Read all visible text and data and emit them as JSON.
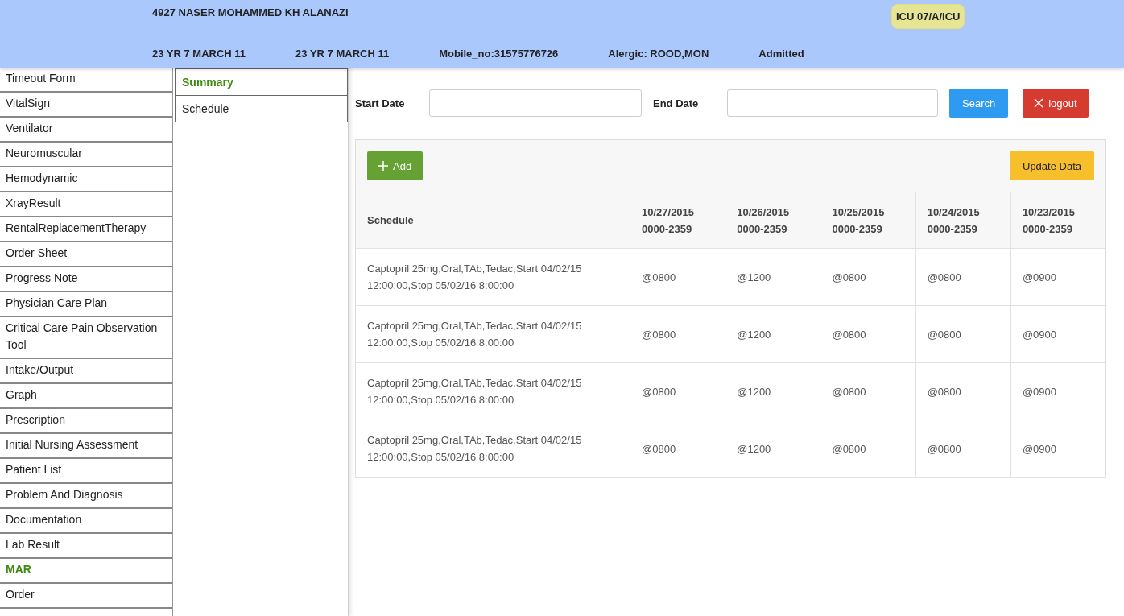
{
  "header": {
    "patient_name": "4927 NASER MOHAMMED KH ALANAZI",
    "location": "ICU 07/A/ICU",
    "details": [
      "23 YR 7 MARCH 11",
      "23 YR 7 MARCH 11",
      "Mobile_no:31575776726",
      "Alergic: ROOD,MON",
      "Admitted"
    ]
  },
  "sidebar": {
    "items": [
      {
        "label": "Timeout Form",
        "selected": false
      },
      {
        "label": "VitalSign",
        "selected": false
      },
      {
        "label": "Ventilator",
        "selected": false
      },
      {
        "label": "Neuromuscular",
        "selected": false
      },
      {
        "label": "Hemodynamic",
        "selected": false
      },
      {
        "label": "XrayResult",
        "selected": false
      },
      {
        "label": "RentalReplacementTherapy",
        "selected": false
      },
      {
        "label": "Order Sheet",
        "selected": false
      },
      {
        "label": "Progress Note",
        "selected": false
      },
      {
        "label": "Physician Care Plan",
        "selected": false
      },
      {
        "label": "Critical Care Pain Observation Tool",
        "selected": false
      },
      {
        "label": "Intake/Output",
        "selected": false
      },
      {
        "label": "Graph",
        "selected": false
      },
      {
        "label": "Prescription",
        "selected": false
      },
      {
        "label": "Initial Nursing Assessment",
        "selected": false
      },
      {
        "label": "Patient List",
        "selected": false
      },
      {
        "label": "Problem And Diagnosis",
        "selected": false
      },
      {
        "label": "Documentation",
        "selected": false
      },
      {
        "label": "Lab Result",
        "selected": false
      },
      {
        "label": "MAR",
        "selected": true
      },
      {
        "label": "Order",
        "selected": false
      }
    ]
  },
  "submenu": {
    "items": [
      {
        "label": "Summary",
        "selected": true
      },
      {
        "label": "Schedule",
        "selected": false
      }
    ]
  },
  "filters": {
    "start_date_label": "Start Date",
    "end_date_label": "End Date",
    "search_button": "Search",
    "logout_button": "logout"
  },
  "toolbar": {
    "add_button": "Add",
    "update_button": "Update Data"
  },
  "table": {
    "columns": [
      "Schedule",
      "10/27/2015\n0000-2359",
      "10/26/2015\n0000-2359",
      "10/25/2015\n0000-2359",
      "10/24/2015\n0000-2359",
      "10/23/2015\n0000-2359"
    ],
    "rows": [
      [
        "Captopril 25mg,Oral,TAb,Tedac,Start 04/02/15 12:00:00,Stop 05/02/16 8:00:00",
        "@0800",
        "@1200",
        "@0800",
        "@0800",
        "@0900"
      ],
      [
        "Captopril 25mg,Oral,TAb,Tedac,Start 04/02/15 12:00:00,Stop 05/02/16 8:00:00",
        "@0800",
        "@1200",
        "@0800",
        "@0800",
        "@0900"
      ],
      [
        "Captopril 25mg,Oral,TAb,Tedac,Start 04/02/15 12:00:00,Stop 05/02/16 8:00:00",
        "@0800",
        "@1200",
        "@0800",
        "@0800",
        "@0900"
      ],
      [
        "Captopril 25mg,Oral,TAb,Tedac,Start 04/02/15 12:00:00,Stop 05/02/16 8:00:00",
        "@0800",
        "@1200",
        "@0800",
        "@0800",
        "@0900"
      ]
    ]
  }
}
